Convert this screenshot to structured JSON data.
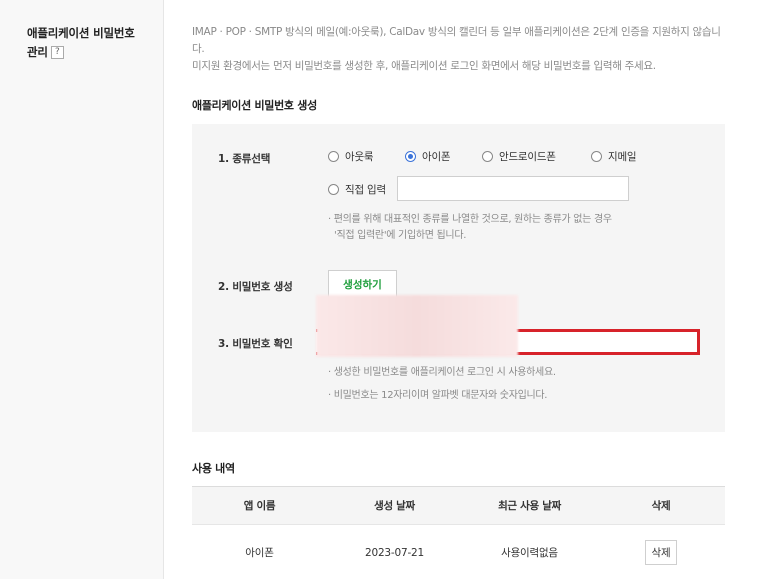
{
  "sidebar": {
    "title_line1": "애플리케이션 비밀번호",
    "title_line2": "관리",
    "help_label": "?"
  },
  "description": {
    "line1": "IMAP · POP · SMTP 방식의 메일(예:아웃룩), CalDav 방식의 캘린더 등 일부 애플리케이션은 2단계 인증을 지원하지 않습니다.",
    "line2": "미지원 환경에서는 먼저 비밀번호를 생성한 후, 애플리케이션 로그인 화면에서 해당 비밀번호를 입력해 주세요."
  },
  "generate": {
    "title": "애플리케이션 비밀번호 생성",
    "step1_label": "1. 종류선택",
    "options": [
      {
        "label": "아웃룩",
        "selected": false
      },
      {
        "label": "아이폰",
        "selected": true
      },
      {
        "label": "안드로이드폰",
        "selected": false
      },
      {
        "label": "지메일",
        "selected": false
      }
    ],
    "direct_option": {
      "label": "직접 입력",
      "selected": false
    },
    "direct_input_value": "",
    "note1_line1": "· 편의를 위해 대표적인 종류를 나열한 것으로, 원하는 종류가 없는 경우",
    "note1_line2": "'직접 입력란'에 기입하면 됩니다.",
    "step2_label": "2. 비밀번호 생성",
    "generate_button": "생성하기",
    "step3_label": "3. 비밀번호 확인",
    "password_value": "",
    "note2": "· 생성한 비밀번호를 애플리케이션 로그인 시 사용하세요.",
    "note3": "· 비밀번호는 12자리이며 알파벳 대문자와 숫자입니다.",
    "accent_color": "#1e9e3c",
    "highlight_color": "#d7232a"
  },
  "usage": {
    "title": "사용 내역",
    "columns": [
      "앱 이름",
      "생성 날짜",
      "최근 사용 날짜",
      "삭제"
    ],
    "rows": [
      {
        "app": "아이폰",
        "created": "2023-07-21",
        "last_used": "사용이력없음",
        "delete_label": "삭제"
      }
    ]
  }
}
